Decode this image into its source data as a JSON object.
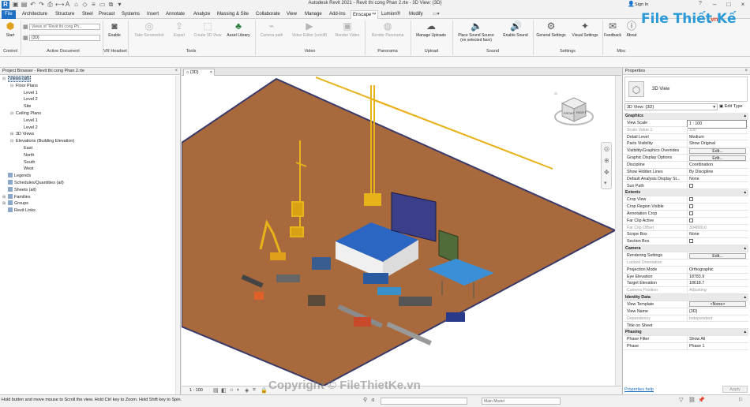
{
  "app": {
    "title": "Autodesk Revit 2021 - Revit thi cong Phan 2.rte - 3D View: {3D}",
    "sign_in": "Sign In"
  },
  "tabs": [
    "File",
    "Architecture",
    "Structure",
    "Steel",
    "Precast",
    "Systems",
    "Insert",
    "Annotate",
    "Analyze",
    "Massing & Site",
    "Collaborate",
    "View",
    "Manage",
    "Add-Ins",
    "Enscape™",
    "Lumion®",
    "Modify"
  ],
  "active_tab": "Enscape™",
  "ribbon": {
    "start": "Start",
    "views_combo": "Views of \"Revit thi cong Ph...",
    "view_combo": "{3D}",
    "enable": "Enable",
    "take_screenshot": "Take Screenshot",
    "export": "Export",
    "create_3d_view": "Create 3D View",
    "asset_library": "Asset Library",
    "camera_path": "Camera path",
    "video_editor": "Video Editor (on/off)",
    "render_video": "Render Video",
    "render_panorama": "Render Panorama",
    "manage_uploads": "Manage Uploads",
    "place_sound_source": "Place Sound Source",
    "place_sound_source_sub": "(on selected face)",
    "enable_sound": "Enable Sound",
    "general_settings": "General Settings",
    "visual_settings": "Visual Settings",
    "feedback": "Feedback",
    "about": "About",
    "panels": [
      "Control",
      "Active Document",
      "VR Headset",
      "Tools",
      "Video",
      "Panorama",
      "Upload",
      "Sound",
      "Settings",
      "Misc"
    ]
  },
  "logo": {
    "main": "File Thiết Kế",
    "suffix": ".vn"
  },
  "project_browser": {
    "title": "Project Browser - Revit thi cong Phan 2.rte",
    "items": [
      {
        "label": "Views (all)",
        "level": 0,
        "toggle": "⊟",
        "selected": true
      },
      {
        "label": "Floor Plans",
        "level": 1,
        "toggle": "⊟"
      },
      {
        "label": "Level 1",
        "level": 2,
        "toggle": ""
      },
      {
        "label": "Level 2",
        "level": 2,
        "toggle": ""
      },
      {
        "label": "Site",
        "level": 2,
        "toggle": ""
      },
      {
        "label": "Ceiling Plans",
        "level": 1,
        "toggle": "⊟"
      },
      {
        "label": "Level 1",
        "level": 2,
        "toggle": ""
      },
      {
        "label": "Level 2",
        "level": 2,
        "toggle": ""
      },
      {
        "label": "3D Views",
        "level": 1,
        "toggle": "⊞"
      },
      {
        "label": "Elevations (Building Elevation)",
        "level": 1,
        "toggle": "⊟"
      },
      {
        "label": "East",
        "level": 2,
        "toggle": ""
      },
      {
        "label": "North",
        "level": 2,
        "toggle": ""
      },
      {
        "label": "South",
        "level": 2,
        "toggle": ""
      },
      {
        "label": "West",
        "level": 2,
        "toggle": ""
      },
      {
        "label": "Legends",
        "level": 0,
        "toggle": "",
        "icon": true
      },
      {
        "label": "Schedules/Quantities (all)",
        "level": 0,
        "toggle": "",
        "icon": true
      },
      {
        "label": "Sheets (all)",
        "level": 0,
        "toggle": "",
        "icon": true
      },
      {
        "label": "Families",
        "level": 0,
        "toggle": "⊞",
        "icon": true
      },
      {
        "label": "Groups",
        "level": 0,
        "toggle": "⊞",
        "icon": true
      },
      {
        "label": "Revit Links",
        "level": 0,
        "toggle": "",
        "icon": true
      }
    ]
  },
  "view": {
    "tab": "{3D}",
    "scale": "1 : 100",
    "viewcube_face": "FRONT",
    "viewcube_side": "RIGHT"
  },
  "properties": {
    "title": "Properties",
    "type_name": "3D View",
    "selector": "3D View: {3D}",
    "edit_type": "Edit Type",
    "rows": [
      {
        "group": "Graphics"
      },
      {
        "k": "View Scale",
        "v": "1 : 100",
        "box": true
      },
      {
        "k": "Scale Value    1:",
        "v": "100",
        "dim": true
      },
      {
        "k": "Detail Level",
        "v": "Medium"
      },
      {
        "k": "Parts Visibility",
        "v": "Show Original"
      },
      {
        "k": "Visibility/Graphics Overrides",
        "btn": "Edit..."
      },
      {
        "k": "Graphic Display Options",
        "btn": "Edit..."
      },
      {
        "k": "Discipline",
        "v": "Coordination"
      },
      {
        "k": "Show Hidden Lines",
        "v": "By Discipline"
      },
      {
        "k": "Default Analysis Display St...",
        "v": "None"
      },
      {
        "k": "Sun Path",
        "chk": true
      },
      {
        "group": "Extents"
      },
      {
        "k": "Crop View",
        "chk": true
      },
      {
        "k": "Crop Region Visible",
        "chk": true
      },
      {
        "k": "Annotation Crop",
        "chk": true
      },
      {
        "k": "Far Clip Active",
        "chk": true
      },
      {
        "k": "Far Clip Offset",
        "v": "304800.0",
        "dim": true
      },
      {
        "k": "Scope Box",
        "v": "None"
      },
      {
        "k": "Section Box",
        "chk": true
      },
      {
        "group": "Camera"
      },
      {
        "k": "Rendering Settings",
        "btn": "Edit..."
      },
      {
        "k": "Locked Orientation",
        "v": "",
        "dim": true
      },
      {
        "k": "Projection Mode",
        "v": "Orthographic"
      },
      {
        "k": "Eye Elevation",
        "v": "18783.9"
      },
      {
        "k": "Target Elevation",
        "v": "18618.7"
      },
      {
        "k": "Camera Position",
        "v": "Adjusting",
        "dim": true
      },
      {
        "group": "Identity Data"
      },
      {
        "k": "View Template",
        "btn": "<None>"
      },
      {
        "k": "View Name",
        "v": "{3D}"
      },
      {
        "k": "Dependency",
        "v": "Independent",
        "dim": true
      },
      {
        "k": "Title on Sheet",
        "v": ""
      },
      {
        "group": "Phasing"
      },
      {
        "k": "Phase Filter",
        "v": "Show All"
      },
      {
        "k": "Phase",
        "v": "Phase 1"
      }
    ],
    "help": "Properties help",
    "apply": "Apply"
  },
  "status": {
    "message": "Hold button and move mouse to Scroll the view. Hold Ctrl key to Zoom. Hold Shift key to Spin.",
    "model": "Main Model",
    "workset_zero": ":0"
  },
  "watermark": "Copyright © FileThietKe.vn",
  "colors": {
    "accent": "#1f6fc3",
    "ground": "#a86a3d",
    "crane": "#e7b21a"
  }
}
